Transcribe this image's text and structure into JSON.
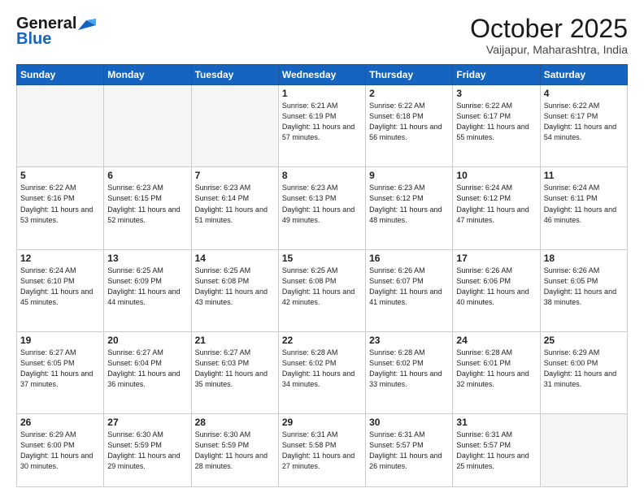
{
  "header": {
    "logo_line1": "General",
    "logo_line2": "Blue",
    "month": "October 2025",
    "location": "Vaijapur, Maharashtra, India"
  },
  "weekdays": [
    "Sunday",
    "Monday",
    "Tuesday",
    "Wednesday",
    "Thursday",
    "Friday",
    "Saturday"
  ],
  "weeks": [
    [
      {
        "day": null
      },
      {
        "day": null
      },
      {
        "day": null
      },
      {
        "day": 1,
        "sunrise": "Sunrise: 6:21 AM",
        "sunset": "Sunset: 6:19 PM",
        "daylight": "Daylight: 11 hours and 57 minutes."
      },
      {
        "day": 2,
        "sunrise": "Sunrise: 6:22 AM",
        "sunset": "Sunset: 6:18 PM",
        "daylight": "Daylight: 11 hours and 56 minutes."
      },
      {
        "day": 3,
        "sunrise": "Sunrise: 6:22 AM",
        "sunset": "Sunset: 6:17 PM",
        "daylight": "Daylight: 11 hours and 55 minutes."
      },
      {
        "day": 4,
        "sunrise": "Sunrise: 6:22 AM",
        "sunset": "Sunset: 6:17 PM",
        "daylight": "Daylight: 11 hours and 54 minutes."
      }
    ],
    [
      {
        "day": 5,
        "sunrise": "Sunrise: 6:22 AM",
        "sunset": "Sunset: 6:16 PM",
        "daylight": "Daylight: 11 hours and 53 minutes."
      },
      {
        "day": 6,
        "sunrise": "Sunrise: 6:23 AM",
        "sunset": "Sunset: 6:15 PM",
        "daylight": "Daylight: 11 hours and 52 minutes."
      },
      {
        "day": 7,
        "sunrise": "Sunrise: 6:23 AM",
        "sunset": "Sunset: 6:14 PM",
        "daylight": "Daylight: 11 hours and 51 minutes."
      },
      {
        "day": 8,
        "sunrise": "Sunrise: 6:23 AM",
        "sunset": "Sunset: 6:13 PM",
        "daylight": "Daylight: 11 hours and 49 minutes."
      },
      {
        "day": 9,
        "sunrise": "Sunrise: 6:23 AM",
        "sunset": "Sunset: 6:12 PM",
        "daylight": "Daylight: 11 hours and 48 minutes."
      },
      {
        "day": 10,
        "sunrise": "Sunrise: 6:24 AM",
        "sunset": "Sunset: 6:12 PM",
        "daylight": "Daylight: 11 hours and 47 minutes."
      },
      {
        "day": 11,
        "sunrise": "Sunrise: 6:24 AM",
        "sunset": "Sunset: 6:11 PM",
        "daylight": "Daylight: 11 hours and 46 minutes."
      }
    ],
    [
      {
        "day": 12,
        "sunrise": "Sunrise: 6:24 AM",
        "sunset": "Sunset: 6:10 PM",
        "daylight": "Daylight: 11 hours and 45 minutes."
      },
      {
        "day": 13,
        "sunrise": "Sunrise: 6:25 AM",
        "sunset": "Sunset: 6:09 PM",
        "daylight": "Daylight: 11 hours and 44 minutes."
      },
      {
        "day": 14,
        "sunrise": "Sunrise: 6:25 AM",
        "sunset": "Sunset: 6:08 PM",
        "daylight": "Daylight: 11 hours and 43 minutes."
      },
      {
        "day": 15,
        "sunrise": "Sunrise: 6:25 AM",
        "sunset": "Sunset: 6:08 PM",
        "daylight": "Daylight: 11 hours and 42 minutes."
      },
      {
        "day": 16,
        "sunrise": "Sunrise: 6:26 AM",
        "sunset": "Sunset: 6:07 PM",
        "daylight": "Daylight: 11 hours and 41 minutes."
      },
      {
        "day": 17,
        "sunrise": "Sunrise: 6:26 AM",
        "sunset": "Sunset: 6:06 PM",
        "daylight": "Daylight: 11 hours and 40 minutes."
      },
      {
        "day": 18,
        "sunrise": "Sunrise: 6:26 AM",
        "sunset": "Sunset: 6:05 PM",
        "daylight": "Daylight: 11 hours and 38 minutes."
      }
    ],
    [
      {
        "day": 19,
        "sunrise": "Sunrise: 6:27 AM",
        "sunset": "Sunset: 6:05 PM",
        "daylight": "Daylight: 11 hours and 37 minutes."
      },
      {
        "day": 20,
        "sunrise": "Sunrise: 6:27 AM",
        "sunset": "Sunset: 6:04 PM",
        "daylight": "Daylight: 11 hours and 36 minutes."
      },
      {
        "day": 21,
        "sunrise": "Sunrise: 6:27 AM",
        "sunset": "Sunset: 6:03 PM",
        "daylight": "Daylight: 11 hours and 35 minutes."
      },
      {
        "day": 22,
        "sunrise": "Sunrise: 6:28 AM",
        "sunset": "Sunset: 6:02 PM",
        "daylight": "Daylight: 11 hours and 34 minutes."
      },
      {
        "day": 23,
        "sunrise": "Sunrise: 6:28 AM",
        "sunset": "Sunset: 6:02 PM",
        "daylight": "Daylight: 11 hours and 33 minutes."
      },
      {
        "day": 24,
        "sunrise": "Sunrise: 6:28 AM",
        "sunset": "Sunset: 6:01 PM",
        "daylight": "Daylight: 11 hours and 32 minutes."
      },
      {
        "day": 25,
        "sunrise": "Sunrise: 6:29 AM",
        "sunset": "Sunset: 6:00 PM",
        "daylight": "Daylight: 11 hours and 31 minutes."
      }
    ],
    [
      {
        "day": 26,
        "sunrise": "Sunrise: 6:29 AM",
        "sunset": "Sunset: 6:00 PM",
        "daylight": "Daylight: 11 hours and 30 minutes."
      },
      {
        "day": 27,
        "sunrise": "Sunrise: 6:30 AM",
        "sunset": "Sunset: 5:59 PM",
        "daylight": "Daylight: 11 hours and 29 minutes."
      },
      {
        "day": 28,
        "sunrise": "Sunrise: 6:30 AM",
        "sunset": "Sunset: 5:59 PM",
        "daylight": "Daylight: 11 hours and 28 minutes."
      },
      {
        "day": 29,
        "sunrise": "Sunrise: 6:31 AM",
        "sunset": "Sunset: 5:58 PM",
        "daylight": "Daylight: 11 hours and 27 minutes."
      },
      {
        "day": 30,
        "sunrise": "Sunrise: 6:31 AM",
        "sunset": "Sunset: 5:57 PM",
        "daylight": "Daylight: 11 hours and 26 minutes."
      },
      {
        "day": 31,
        "sunrise": "Sunrise: 6:31 AM",
        "sunset": "Sunset: 5:57 PM",
        "daylight": "Daylight: 11 hours and 25 minutes."
      },
      {
        "day": null
      }
    ]
  ]
}
